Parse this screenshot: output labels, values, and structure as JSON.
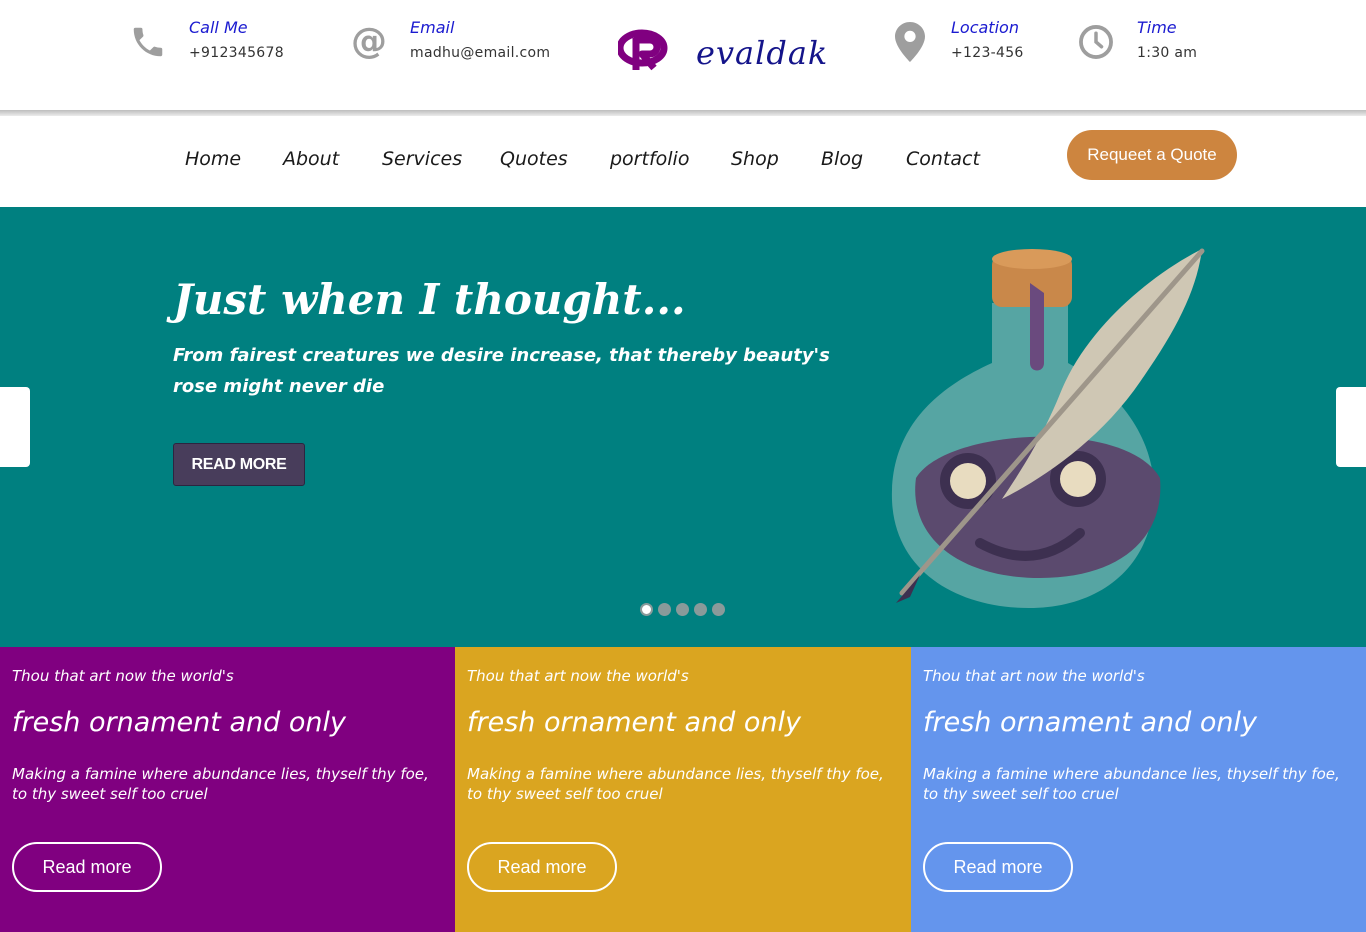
{
  "contact_bar": {
    "items": [
      {
        "label": "Call Me",
        "value": "+912345678",
        "icon": "phone-icon"
      },
      {
        "label": "Email",
        "value": "madhu@email.com",
        "icon": "at-icon"
      },
      {
        "label": "Location",
        "value": "+123-456",
        "icon": "location-pin-icon"
      },
      {
        "label": "Time",
        "value": "1:30 am",
        "icon": "clock-icon"
      }
    ],
    "logo_text": "evaldak"
  },
  "nav": {
    "items": [
      "Home",
      "About",
      "Services",
      "Quotes",
      "portfolio",
      "Shop",
      "Blog",
      "Contact"
    ],
    "cta_label": "Requeet a Quote"
  },
  "hero": {
    "title": "Just when I thought...",
    "subtitle": "From fairest creatures we desire increase, that thereby beauty's rose might never die",
    "button_label": "READ MORE",
    "slide_count": 5,
    "active_slide": 1
  },
  "cards": [
    {
      "kicker": "Thou that art now the world's",
      "heading": "fresh ornament and only",
      "body": "Making a famine where abundance lies, thyself thy foe, to thy sweet self too cruel",
      "button_label": "Read more",
      "color": "#800080"
    },
    {
      "kicker": "Thou that art now the world's",
      "heading": "fresh ornament and only",
      "body": "Making a famine where abundance lies, thyself thy foe, to thy sweet self too cruel",
      "button_label": "Read more",
      "color": "#daa520"
    },
    {
      "kicker": "Thou that art now the world's",
      "heading": "fresh ornament and only",
      "body": "Making a famine where abundance lies, thyself thy foe, to thy sweet self too cruel",
      "button_label": "Read more",
      "color": "#6495ed"
    }
  ],
  "colors": {
    "accent_link": "#1b1bd0",
    "logo_mark": "#800080",
    "logo_text": "#14148a",
    "cta": "#cd853f",
    "hero_bg": "#008080",
    "hero_button": "#483d5b"
  }
}
